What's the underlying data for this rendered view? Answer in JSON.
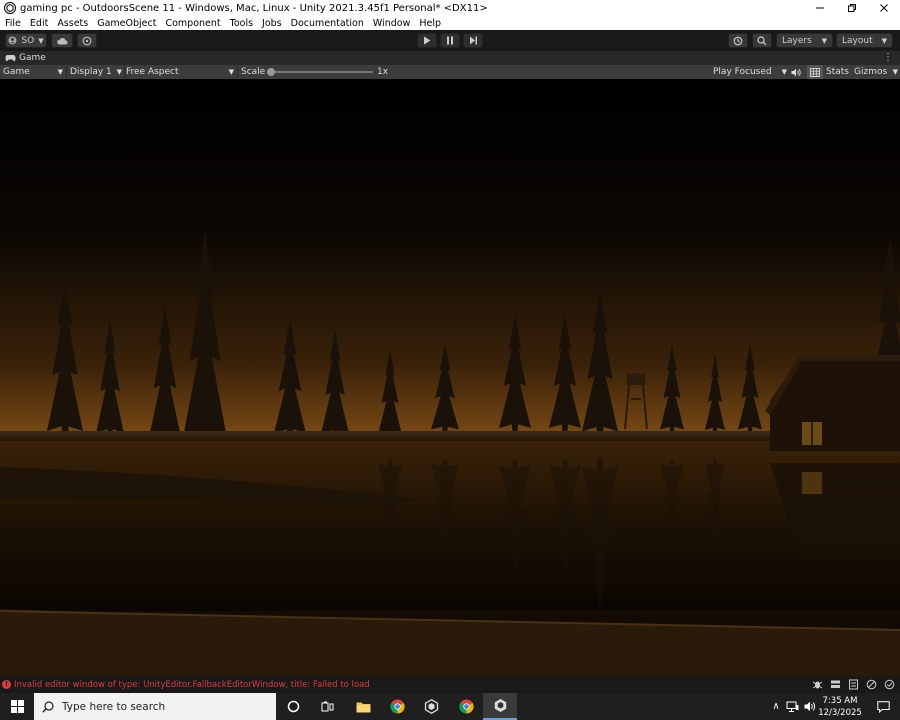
{
  "window": {
    "title": "gaming pc - OutdoorsScene 11 - Windows, Mac, Linux - Unity 2021.3.45f1 Personal* <DX11>"
  },
  "menu": [
    "File",
    "Edit",
    "Assets",
    "GameObject",
    "Component",
    "Tools",
    "Jobs",
    "Documentation",
    "Window",
    "Help"
  ],
  "toolbar": {
    "account_label": "SO",
    "layers_label": "Layers",
    "layout_label": "Layout"
  },
  "tab": {
    "label": "Game"
  },
  "game_controls": {
    "view_mode": "Game",
    "display": "Display 1",
    "aspect": "Free Aspect",
    "scale_label": "Scale",
    "scale_value": "1x",
    "scale_fraction": 0,
    "play_mode": "Play Focused",
    "stats_label": "Stats",
    "gizmos_label": "Gizmos"
  },
  "status": {
    "error_message": "Invalid editor window of type: UnityEditor.FallbackEditorWindow, title: Failed to load"
  },
  "taskbar": {
    "search_placeholder": "Type here to search",
    "time": "7:35 AM",
    "date": "12/3/2025"
  },
  "colors": {
    "editor_dark": "#191919",
    "panel": "#3c3c3c",
    "error_red": "#e03a3a",
    "sky_glow": "#8a5a1e"
  },
  "icons": [
    "unity-icon",
    "minimize-icon",
    "restore-icon",
    "close-icon",
    "account-icon",
    "cloud-icon",
    "collab-icon",
    "play-icon",
    "pause-icon",
    "step-icon",
    "history-icon",
    "search-icon",
    "game-controller-icon",
    "audio-icon",
    "stats-grid-icon",
    "windows-start-icon",
    "cortana-icon",
    "task-view-icon",
    "file-explorer-icon",
    "chrome-icon",
    "unity-hub-icon",
    "network-icon",
    "volume-icon",
    "notification-icon"
  ]
}
